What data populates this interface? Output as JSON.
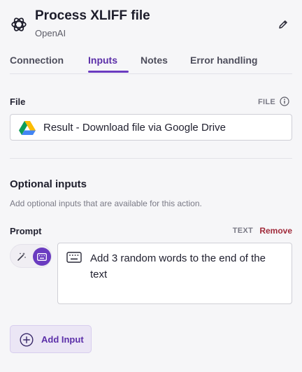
{
  "header": {
    "title": "Process XLIFF file",
    "subtitle": "OpenAI",
    "logo_icon": "openai-logo-icon",
    "edit_icon": "pencil-icon"
  },
  "tabs": [
    {
      "label": "Connection",
      "active": false
    },
    {
      "label": "Inputs",
      "active": true
    },
    {
      "label": "Notes",
      "active": false
    },
    {
      "label": "Error handling",
      "active": false
    }
  ],
  "file_field": {
    "label": "File",
    "type_hint": "FILE",
    "info_icon": "info-icon",
    "value": "Result - Download file via Google Drive",
    "value_icon": "google-drive-icon"
  },
  "optional": {
    "title": "Optional inputs",
    "description": "Add optional inputs that are available for this action."
  },
  "prompt_field": {
    "label": "Prompt",
    "type_hint": "TEXT",
    "remove_label": "Remove",
    "value": "Add 3 random words to the end of the text",
    "mode_icons": [
      "magic-wand-icon",
      "keyboard-icon"
    ]
  },
  "add_input": {
    "label": "Add Input",
    "icon": "plus-circle-icon"
  },
  "colors": {
    "accent": "#6a3bc0",
    "remove": "#a02a3a",
    "background": "#f6f6f8"
  }
}
